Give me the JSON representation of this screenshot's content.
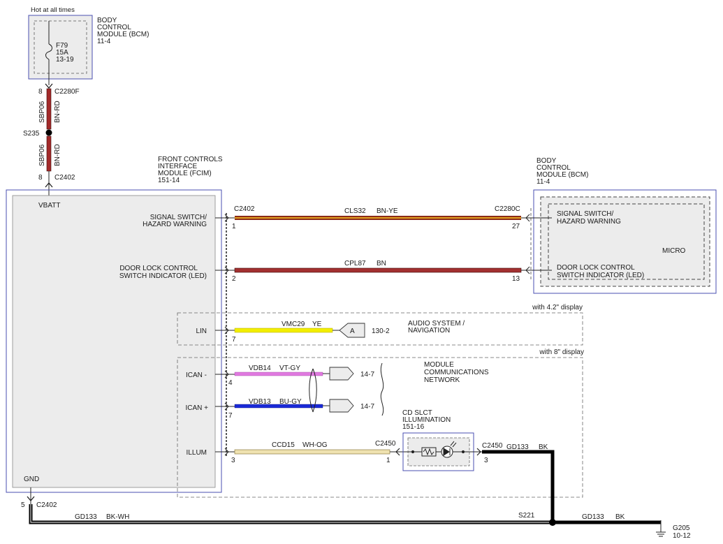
{
  "colors": {
    "module_border": "#4a4fb0",
    "module_fill": "#ececec",
    "wire_bn_rd": "#a32a2a",
    "wire_bn_ye_outer": "#8b2a16",
    "wire_bn_ye_inner": "#e0a020",
    "wire_bn": "#a33030",
    "wire_ye": "#f2ee00",
    "wire_vt_gy": "#e07ae0",
    "wire_bu_gy": "#1a2ad8",
    "wire_wh_og": "#efe2b0",
    "wire_bk": "#000000"
  },
  "top_supply": {
    "label": "Hot at all times",
    "bcm_title": [
      "BODY",
      "CONTROL",
      "MODULE (BCM)",
      "11-4"
    ],
    "fuse": [
      "F79",
      "15A",
      "13-19"
    ]
  },
  "upper_connector": {
    "pin": "8",
    "name": "C2280F"
  },
  "wire_top_segment": {
    "circuit": "SBP06",
    "color": "BN-RD"
  },
  "splice_top": {
    "name": "S235"
  },
  "wire_bottom_segment": {
    "circuit": "SBP06",
    "color": "BN-RD"
  },
  "fcim_entry_connector": {
    "pin": "8",
    "name": "C2402"
  },
  "fcim": {
    "title": [
      "FRONT CONTROLS",
      "INTERFACE",
      "MODULE (FCIM)",
      "151-14"
    ],
    "vbatt": "VBATT",
    "gnd": "GND",
    "signal_switch": [
      "SIGNAL SWITCH/",
      "HAZARD WARNING"
    ],
    "door_lock": [
      "DOOR LOCK CONTROL",
      "SWITCH INDICATOR (LED)"
    ],
    "lin": "LIN",
    "ican_minus": "ICAN -",
    "ican_plus": "ICAN +",
    "illum": "ILLUM"
  },
  "bcm_right": {
    "title": [
      "BODY",
      "CONTROL",
      "MODULE (BCM)",
      "11-4"
    ],
    "signal_switch": [
      "SIGNAL SWITCH/",
      "HAZARD WARNING"
    ],
    "micro": "MICRO",
    "door_lock": [
      "DOOR LOCK CONTROL",
      "SWITCH INDICATOR (LED)"
    ]
  },
  "wires": {
    "cls32": {
      "left_connector": "C2402",
      "left_pin": "1",
      "circuit": "CLS32",
      "color": "BN-YE",
      "right_connector": "C2280C",
      "right_pin": "27"
    },
    "cpl87": {
      "left_pin": "2",
      "circuit": "CPL87",
      "color": "BN",
      "right_pin": "13"
    },
    "vmc29": {
      "pin": "7",
      "circuit": "VMC29",
      "color": "YE",
      "ref_letter": "A",
      "ref": "130-2"
    },
    "vdb14": {
      "pin": "4",
      "circuit": "VDB14",
      "color": "VT-GY",
      "ref": "14-7"
    },
    "vdb13": {
      "pin": "7",
      "circuit": "VDB13",
      "color": "BU-GY",
      "ref": "14-7"
    },
    "ccd15": {
      "left_pin": "3",
      "circuit": "CCD15",
      "color": "WH-OG",
      "connector": "C2450",
      "right_pin": "1"
    },
    "gd133_illum": {
      "connector": "C2450",
      "circuit": "GD133",
      "color": "BK",
      "pin": "3"
    },
    "gd133_main": {
      "connector": "C2402",
      "pin": "5",
      "circuit": "GD133",
      "color": "BK-WH"
    },
    "gd133_ground": {
      "circuit": "GD133",
      "color": "BK"
    }
  },
  "audio_group": {
    "note": "with 4.2\" display",
    "title": [
      "AUDIO SYSTEM /",
      "NAVIGATION"
    ]
  },
  "can_group": {
    "note": "with 8\" display",
    "title": [
      "MODULE",
      "COMMUNICATIONS",
      "NETWORK"
    ]
  },
  "cd_slct": {
    "title": [
      "CD SLCT",
      "ILLUMINATION",
      "151-16"
    ]
  },
  "splice_bottom": {
    "name": "S221"
  },
  "ground": {
    "name": "G205",
    "ref": "10-12"
  }
}
